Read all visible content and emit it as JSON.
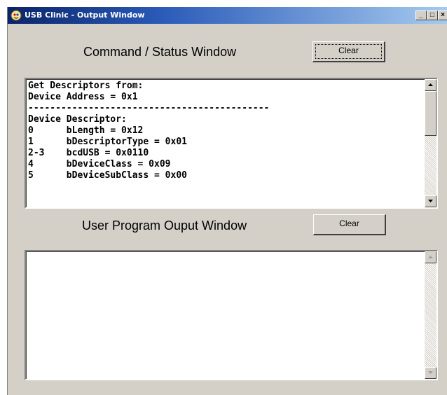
{
  "window": {
    "title": "USB Clinic - Output Window",
    "icon": "usb-clinic-app-icon",
    "controls": {
      "minimize": "_",
      "maximize": "□",
      "close": "×"
    }
  },
  "command_panel": {
    "heading": "Command / Status Window",
    "clear_label": "Clear",
    "lines": [
      "Get Descriptors from:",
      "Device Address = 0x1",
      "--------------------------------------------",
      "Device Descriptor:",
      "0      bLength = 0x12",
      "1      bDescriptorType = 0x01",
      "2-3    bcdUSB = 0x0110",
      "4      bDeviceClass = 0x09",
      "5      bDeviceSubClass = 0x00"
    ]
  },
  "user_panel": {
    "heading": "User Program Ouput Window",
    "clear_label": "Clear",
    "text": ""
  }
}
